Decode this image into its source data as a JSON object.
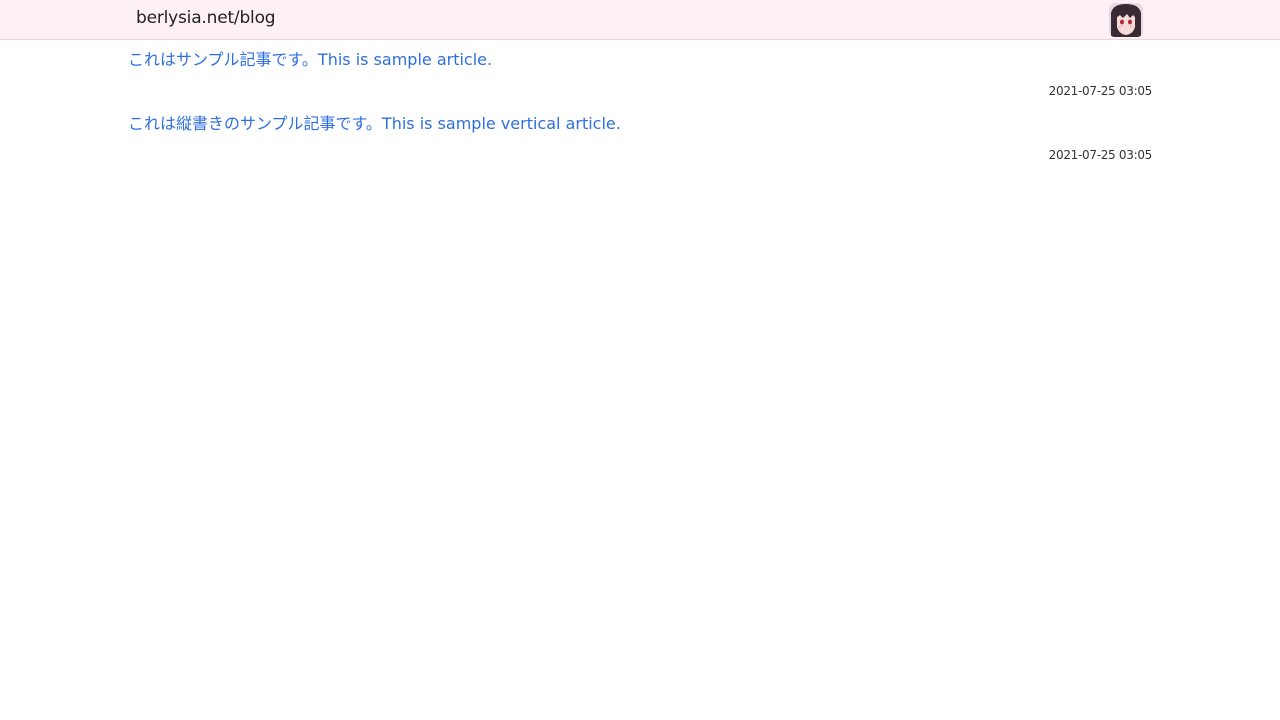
{
  "header": {
    "site_title": "berlysia.net/blog",
    "avatar_icon": "user-avatar-icon",
    "background_color": "#fdf1f6"
  },
  "articles": [
    {
      "title": "これはサンプル記事です。This is sample article.",
      "date": "2021-07-25 03:05"
    },
    {
      "title": "これは縦書きのサンプル記事です。This is sample vertical article.",
      "date": "2021-07-25 03:05"
    }
  ],
  "colors": {
    "link": "#2f6fe0",
    "text": "#222222"
  }
}
